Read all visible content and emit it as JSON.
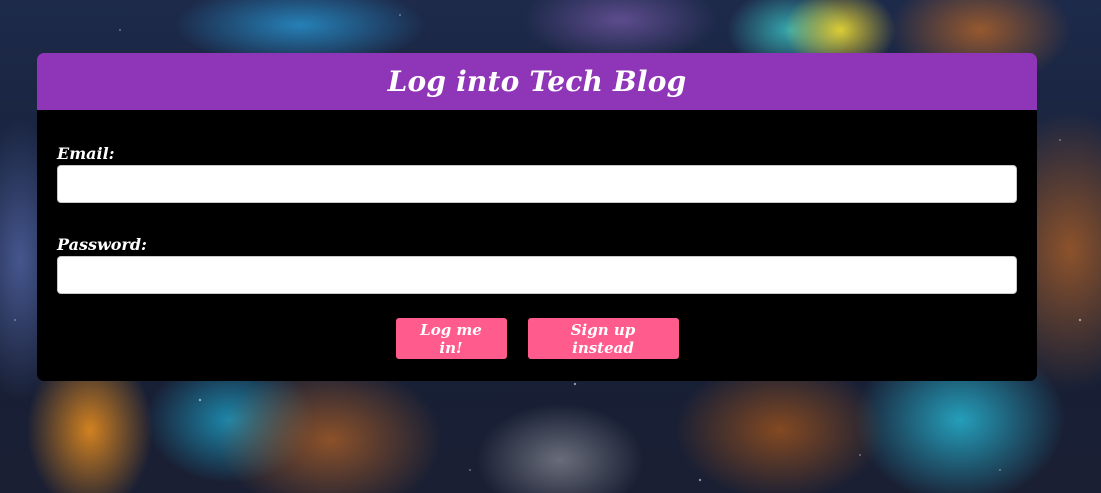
{
  "login_card": {
    "title": "Log into Tech Blog",
    "email": {
      "label": "Email:",
      "value": "",
      "placeholder": ""
    },
    "password": {
      "label": "Password:",
      "value": "",
      "placeholder": ""
    },
    "buttons": {
      "login_label": "Log me in!",
      "signup_label": "Sign up instead"
    }
  },
  "colors": {
    "header_bg": "#8f35b7",
    "card_bg": "#000000",
    "button_bg": "#ff5b8c",
    "text": "#ffffff"
  },
  "background": {
    "description_icon": "galaxy-nebula-background"
  }
}
